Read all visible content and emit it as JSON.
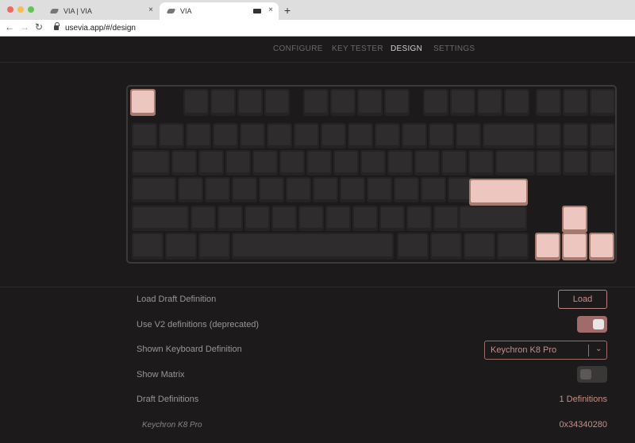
{
  "browser": {
    "traffic_colors": [
      "#ed6a5e",
      "#f5bf4f",
      "#61c554"
    ],
    "tabs": [
      {
        "title": "VIA | VIA",
        "close": "×"
      },
      {
        "title": "VIA",
        "close": "×"
      }
    ],
    "new_tab": "+",
    "nav": {
      "back": "←",
      "forward": "→",
      "reload": "↻"
    },
    "url": "usevia.app/#/design"
  },
  "app_nav": {
    "items": [
      "CONFIGURE",
      "KEY TESTER",
      "DESIGN",
      "SETTINGS"
    ],
    "active": "DESIGN"
  },
  "keyboard": {
    "layout": "Keychron K8 Pro",
    "highlight_color": "#edc6bf",
    "key_color": "#2e2c2c",
    "highlighted_keys": [
      "Esc",
      "Enter",
      "Up",
      "Left",
      "Down",
      "Right"
    ]
  },
  "settings": {
    "load_draft": {
      "label": "Load Draft Definition",
      "button": "Load"
    },
    "use_v2": {
      "label": "Use V2 definitions (deprecated)",
      "enabled": true
    },
    "shown_definition": {
      "label": "Shown Keyboard Definition",
      "value": "Keychron K8 Pro",
      "chevron": "⌄"
    },
    "show_matrix": {
      "label": "Show Matrix",
      "enabled": false
    },
    "draft_definitions": {
      "label": "Draft Definitions",
      "value": "1 Definitions"
    },
    "draft_item": {
      "name": "Keychron K8 Pro",
      "id": "0x34340280"
    }
  }
}
